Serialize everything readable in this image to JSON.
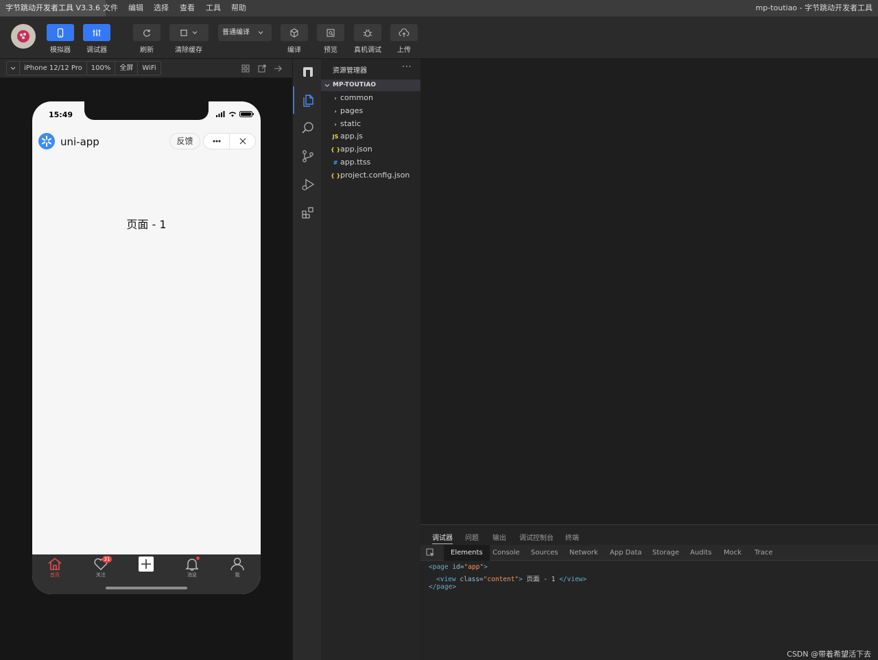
{
  "menubar": {
    "app_title": "字节跳动开发者工具 V3.3.6",
    "items": [
      "文件",
      "编辑",
      "选择",
      "查看",
      "工具",
      "帮助"
    ],
    "window_title": "mp-toutiao - 字节跳动开发者工具"
  },
  "toolbar": {
    "simulator_label": "模拟器",
    "debugger_label": "调试器",
    "refresh_label": "刷新",
    "clear_cache_label": "清除缓存",
    "compile_mode": "普通编译",
    "compile_label": "编译",
    "preview_label": "预览",
    "remote_debug_label": "真机调试",
    "upload_label": "上传"
  },
  "simulator_bar": {
    "device": "iPhone 12/12 Pro",
    "zoom": "100%",
    "fullscreen": "全屏",
    "network": "WiFi"
  },
  "phone": {
    "status_time": "15:49",
    "app_name": "uni-app",
    "feedback": "反馈",
    "page_text": "页面 - 1",
    "tabs": [
      {
        "label": "首页",
        "icon": "home-icon",
        "active": true
      },
      {
        "label": "关注",
        "icon": "heart-icon",
        "badge": "31"
      },
      {
        "label": "",
        "icon": "plus-icon"
      },
      {
        "label": "消息",
        "icon": "bell-icon",
        "dot": true
      },
      {
        "label": "我",
        "icon": "user-icon"
      }
    ]
  },
  "explorer": {
    "title": "资源管理器",
    "more": "···",
    "project": "MP-TOUTIAO",
    "items": [
      {
        "name": "common",
        "type": "folder"
      },
      {
        "name": "pages",
        "type": "folder"
      },
      {
        "name": "static",
        "type": "folder"
      },
      {
        "name": "app.js",
        "type": "js",
        "icon": "JS"
      },
      {
        "name": "app.json",
        "type": "json",
        "icon": "{ }"
      },
      {
        "name": "app.ttss",
        "type": "css",
        "icon": "#"
      },
      {
        "name": "project.config.json",
        "type": "json",
        "icon": "{ }"
      }
    ]
  },
  "debugger": {
    "top_tabs": [
      "调试器",
      "问题",
      "输出",
      "调试控制台",
      "终端"
    ],
    "devtools_tabs": [
      "Elements",
      "Console",
      "Sources",
      "Network",
      "App Data",
      "Storage",
      "Audits",
      "Mock",
      "Trace"
    ],
    "code": {
      "line1_open": "<page",
      "line1_attr": " id=",
      "line1_val": "\"app\"",
      "line1_close": ">",
      "line2_open": "<view",
      "line2_attr": " class=",
      "line2_val": "\"content\"",
      "line2_gt": ">",
      "line2_text": " 页面 - 1 ",
      "line2_end": "</view>",
      "line3": "</page>"
    }
  },
  "watermark": "CSDN @带着希望活下去",
  "colors": {
    "accent": "#3478f6",
    "badge": "#e54545",
    "active_tab": "#e0504f"
  }
}
